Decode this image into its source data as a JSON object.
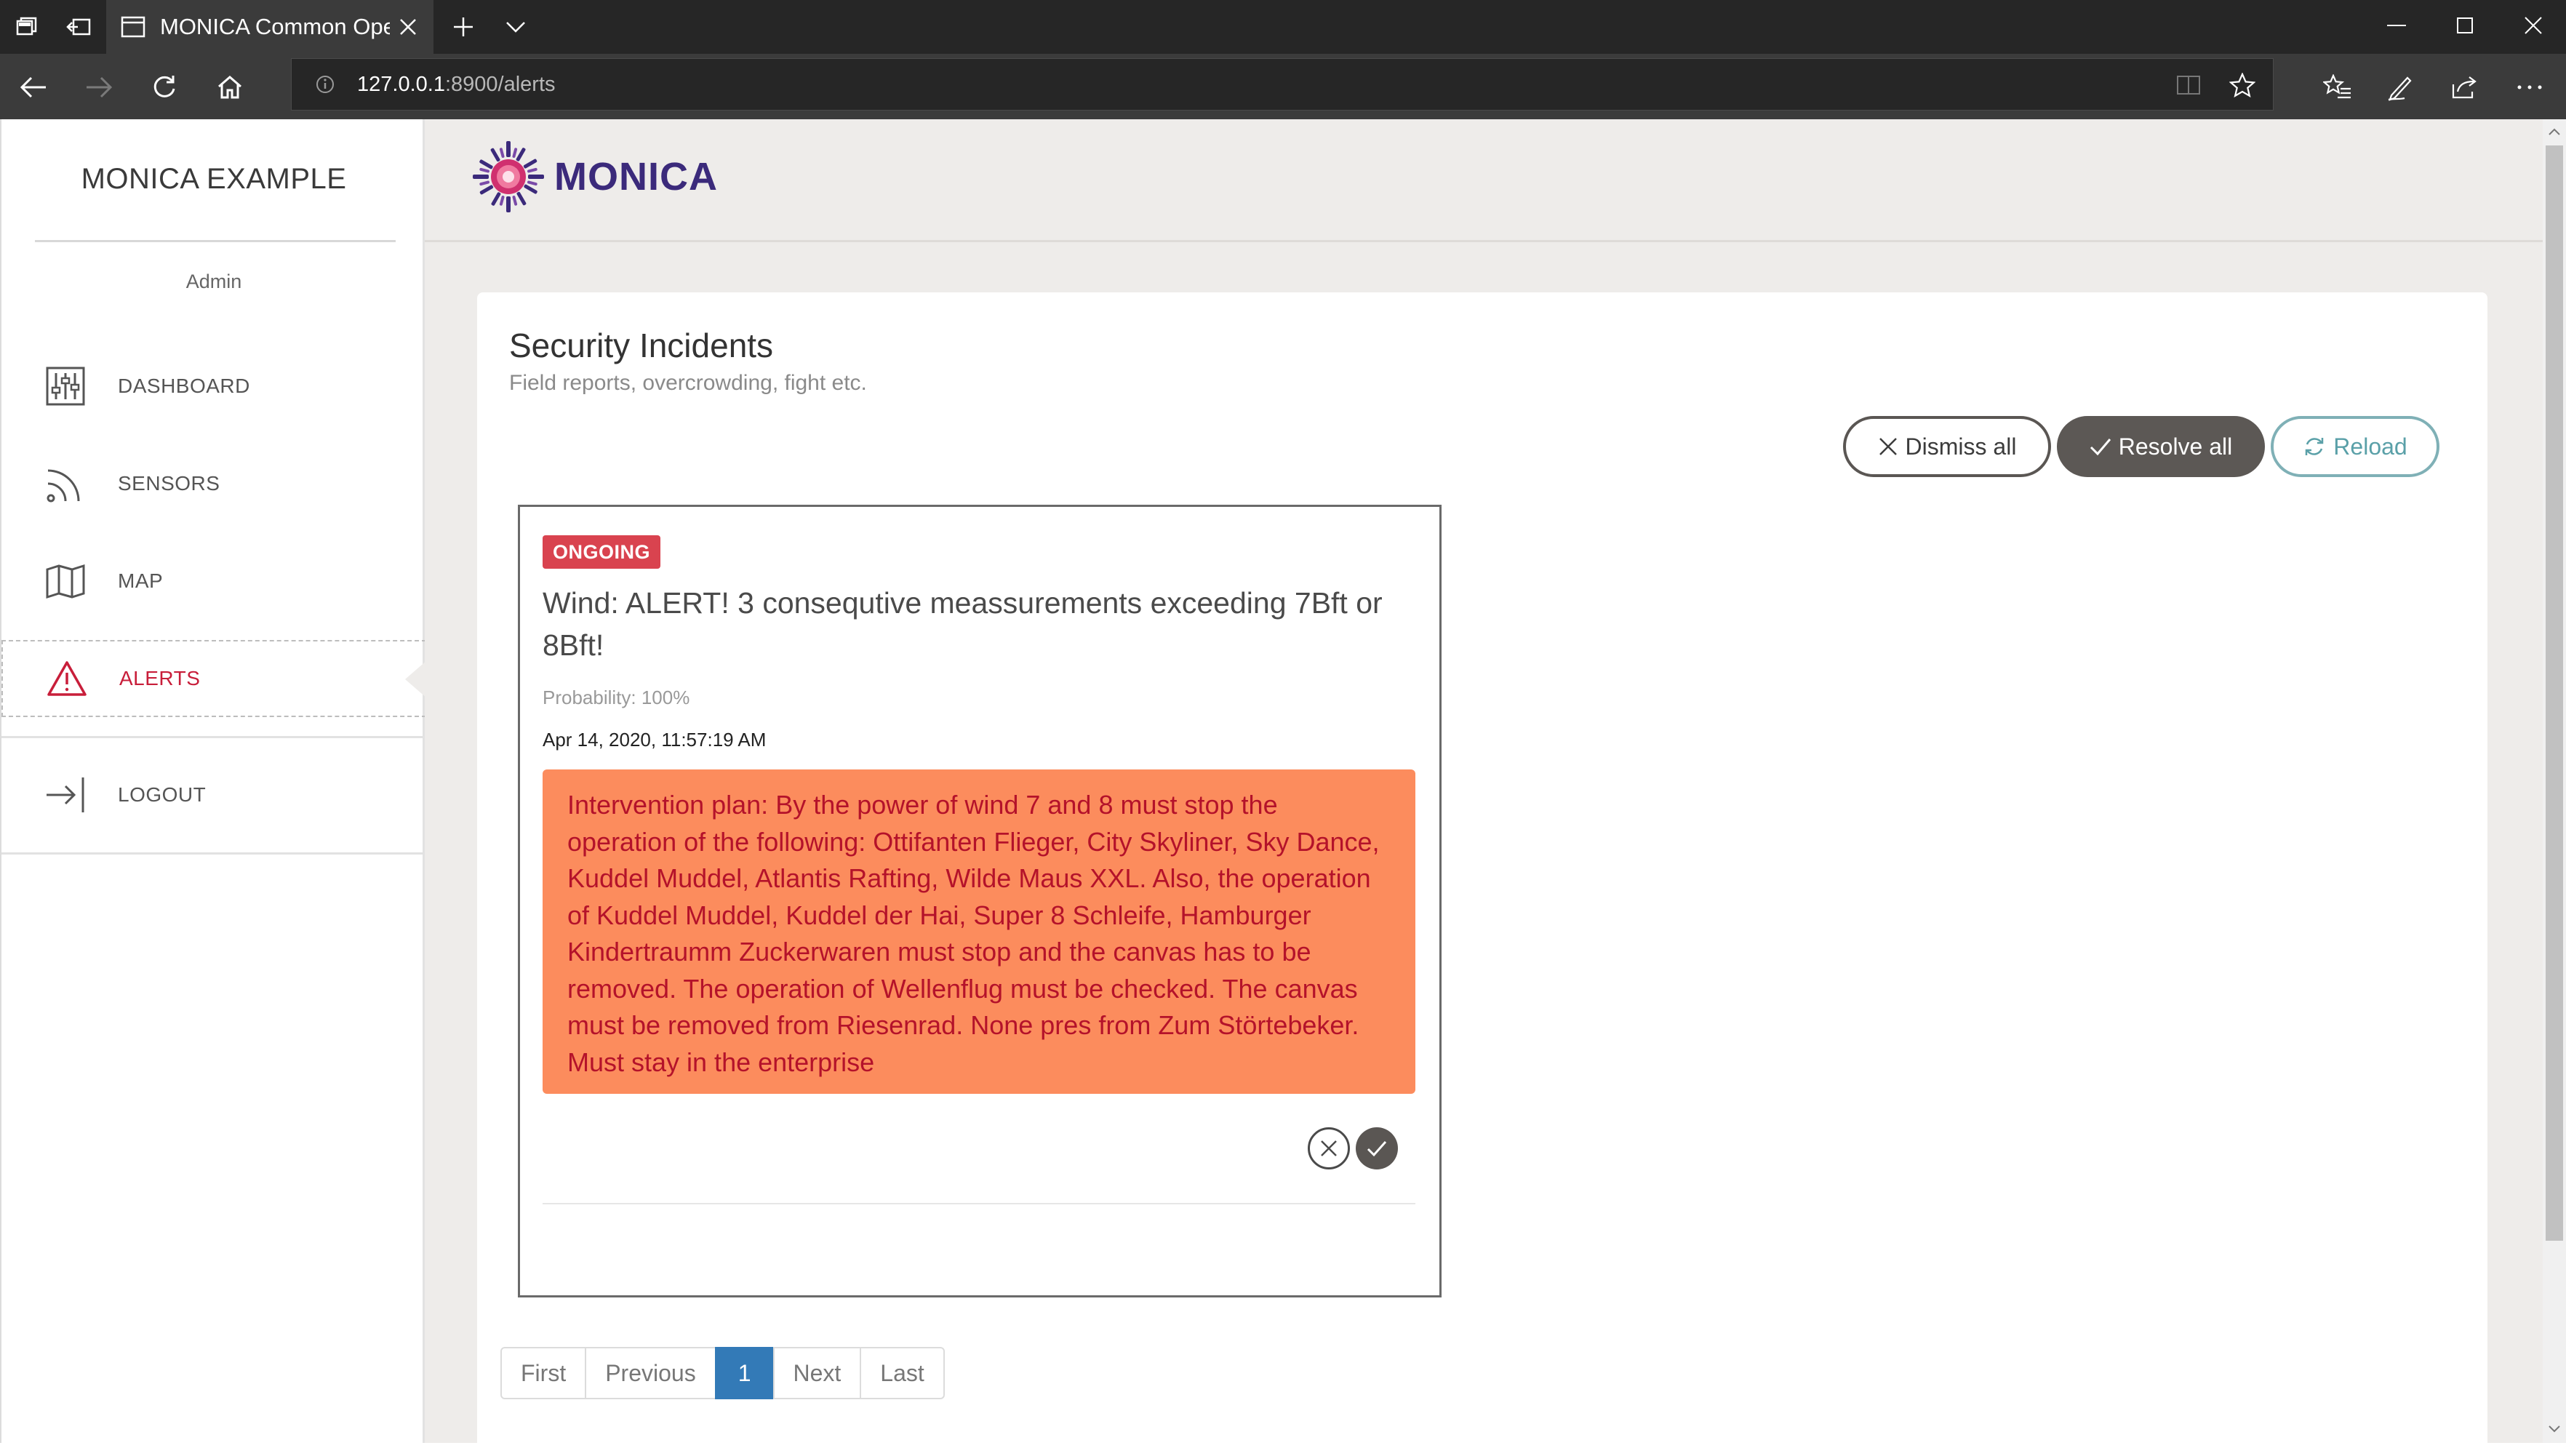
{
  "browser": {
    "tab_title": "MONICA Common Ope",
    "url_host": "127.0.0.1",
    "url_path": ":8900/alerts"
  },
  "sidebar": {
    "app_name": "MONICA EXAMPLE",
    "user": "Admin",
    "items": [
      {
        "label": "DASHBOARD",
        "icon": "sliders-icon"
      },
      {
        "label": "SENSORS",
        "icon": "rss-icon"
      },
      {
        "label": "MAP",
        "icon": "map-icon"
      },
      {
        "label": "ALERTS",
        "icon": "warning-triangle-icon",
        "active": true
      },
      {
        "label": "LOGOUT",
        "icon": "logout-icon"
      }
    ]
  },
  "header": {
    "logo_text": "MONICA"
  },
  "panel": {
    "title": "Security Incidents",
    "subtitle": "Field reports, overcrowding, fight etc.",
    "buttons": {
      "dismiss_all": "Dismiss all",
      "resolve_all": "Resolve all",
      "reload": "Reload"
    }
  },
  "alert": {
    "status": "ONGOING",
    "title": "Wind: ALERT! 3 consequtive meassurements exceeding 7Bft or 8Bft!",
    "probability": "Probability: 100%",
    "timestamp": "Apr 14, 2020, 11:57:19 AM",
    "plan": "Intervention plan: By the power of wind 7 and 8 must stop the operation of the following: Ottifanten Flieger, City Skyliner, Sky Dance, Kuddel Muddel, Atlantis Rafting, Wilde Maus XXL. Also, the operation of Kuddel Muddel, Kuddel der Hai, Super 8 Schleife, Hamburger Kindertraumm Zuckerwaren must stop and the canvas has to be removed. The operation of Wellenflug must be checked. The canvas must be removed from Riesenrad. None pres from Zum Störtebeker. Must stay in the enterprise"
  },
  "pagination": {
    "first": "First",
    "previous": "Previous",
    "current": "1",
    "next": "Next",
    "last": "Last"
  },
  "colors": {
    "accent_red": "#c81e3a",
    "badge_red": "#d9434f",
    "plan_orange": "#fc8c5d",
    "brand_purple": "#3b2a7b",
    "pager_blue": "#337ab7"
  }
}
